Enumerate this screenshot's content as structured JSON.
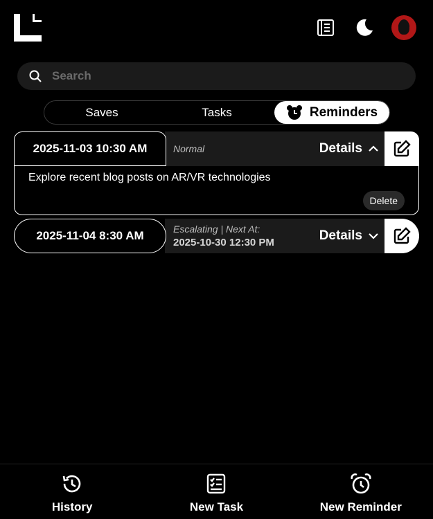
{
  "search": {
    "placeholder": "Search"
  },
  "tabs": [
    {
      "label": "Saves",
      "active": false
    },
    {
      "label": "Tasks",
      "active": false
    },
    {
      "label": "Reminders",
      "active": true
    }
  ],
  "reminders": [
    {
      "datetime": "2025-11-03 10:30 AM",
      "status": "Normal",
      "status_sub": "",
      "details_label": "Details",
      "expanded": true,
      "body": "Explore recent blog posts on AR/VR technologies",
      "delete_label": "Delete"
    },
    {
      "datetime": "2025-11-04 8:30 AM",
      "status": "Escalating | Next At:",
      "status_sub": "2025-10-30 12:30 PM",
      "details_label": "Details",
      "expanded": false
    }
  ],
  "bottom_nav": [
    {
      "label": "History",
      "icon": "history-icon"
    },
    {
      "label": "New Task",
      "icon": "new-task-icon"
    },
    {
      "label": "New Reminder",
      "icon": "alarm-clock-icon"
    }
  ],
  "colors": {
    "background": "#000000",
    "surface": "#1b1b1b",
    "accent": "#ffffff",
    "muted": "#6a6a6a"
  }
}
